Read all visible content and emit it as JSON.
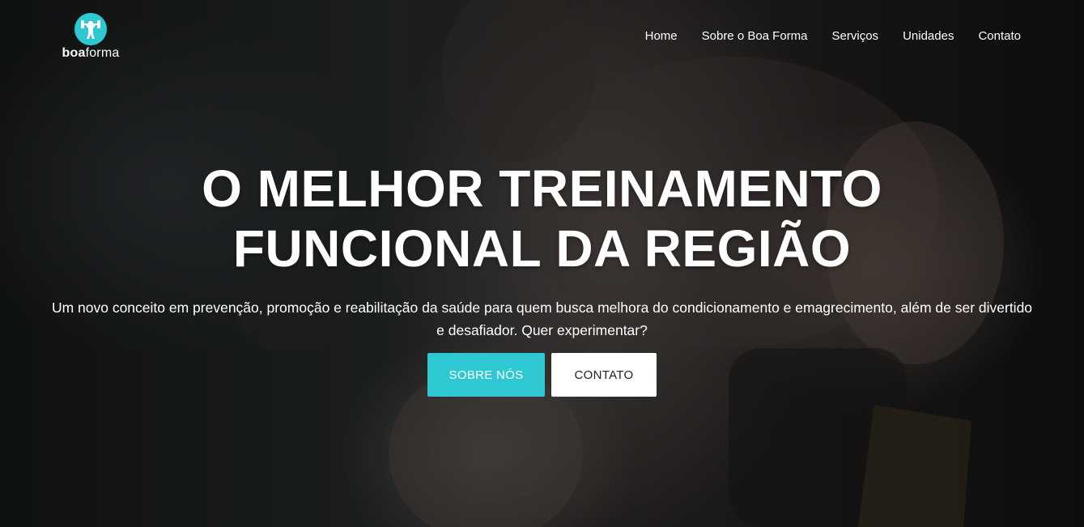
{
  "brand": {
    "name_bold": "boa",
    "name_light": "forma",
    "accent_color": "#2dc8d2",
    "logo_icon": "weightlifter-icon"
  },
  "nav": {
    "items": [
      "Home",
      "Sobre o Boa Forma",
      "Serviços",
      "Unidades",
      "Contato"
    ]
  },
  "hero": {
    "title_line1": "O MELHOR TREINAMENTO",
    "title_line2": "FUNCIONAL DA REGIÃO",
    "subtitle": "Um novo conceito em prevenção, promoção e reabilitação da saúde para quem busca melhora do condicionamento e emagrecimento, além de ser divertido e desafiador. Quer experimentar?",
    "primary_button": "SOBRE NÓS",
    "secondary_button": "CONTATO"
  }
}
